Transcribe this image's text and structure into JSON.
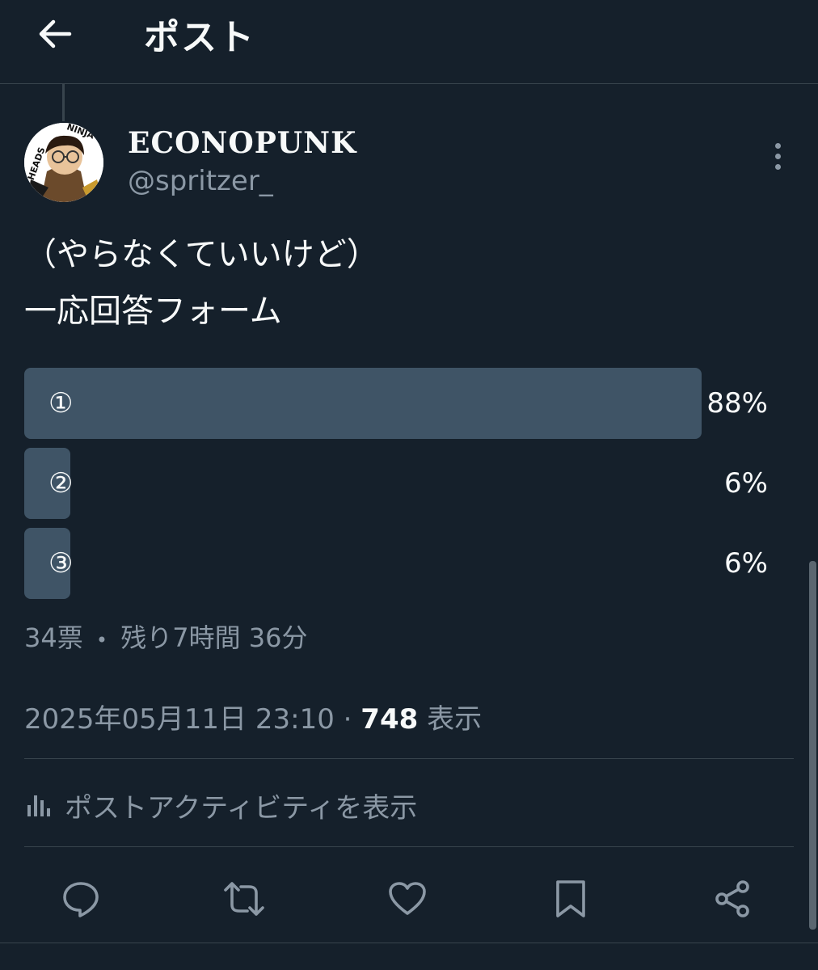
{
  "header": {
    "title": "ポスト",
    "back_icon": "arrow-left-icon"
  },
  "author": {
    "display_name": "ECONOPUNK",
    "handle": "@spritzer_",
    "avatar_text_top": "NINJA",
    "avatar_text_side": "HEADS"
  },
  "post": {
    "text": "（やらなくていいけど）\n一応回答フォーム"
  },
  "poll": {
    "options": [
      {
        "label": "①",
        "percent_label": "88%",
        "percent": 88
      },
      {
        "label": "②",
        "percent_label": "6%",
        "percent": 6
      },
      {
        "label": "③",
        "percent_label": "6%",
        "percent": 6
      }
    ],
    "votes": "34票",
    "separator": "•",
    "remaining": "残り7時間 36分"
  },
  "meta": {
    "timestamp": "2025年05月11日 23:10 · ",
    "views_count": "748",
    "views_label": " 表示"
  },
  "activity": {
    "label": "ポストアクティビティを表示"
  },
  "actions": [
    "reply-icon",
    "repost-icon",
    "like-icon",
    "bookmark-icon",
    "share-icon"
  ],
  "colors": {
    "background": "#15202b",
    "bar": "#3f5466",
    "muted": "#8b98a5",
    "text": "#f7f9f9",
    "border": "#38444d"
  }
}
